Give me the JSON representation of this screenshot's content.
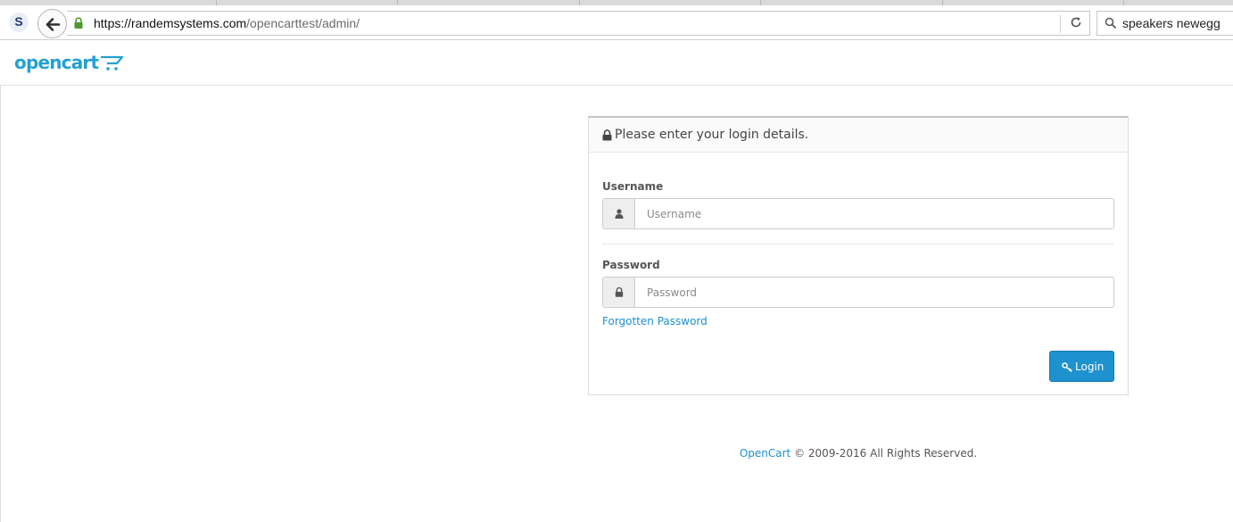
{
  "browser": {
    "url_host": "https://randemsystems.com",
    "url_path": "/opencarttest/admin/",
    "search_text": "speakers newegg"
  },
  "header": {
    "logo_text": "opencart"
  },
  "login": {
    "heading": "Please enter your login details.",
    "username_label": "Username",
    "username_placeholder": "Username",
    "password_label": "Password",
    "password_placeholder": "Password",
    "forgot_link": "Forgotten Password",
    "login_button": "Login"
  },
  "footer": {
    "brand_link": "OpenCart",
    "copyright": "© 2009-2016 All Rights Reserved."
  },
  "colors": {
    "accent": "#1e91cf",
    "logo": "#23a1d1",
    "secure_lock": "#4d9a2d"
  },
  "icons": [
    "s-extension-icon",
    "back-arrow-icon",
    "secure-lock-icon",
    "reload-icon",
    "search-icon",
    "shopping-cart-icon",
    "lock-icon",
    "user-icon",
    "key-icon"
  ]
}
